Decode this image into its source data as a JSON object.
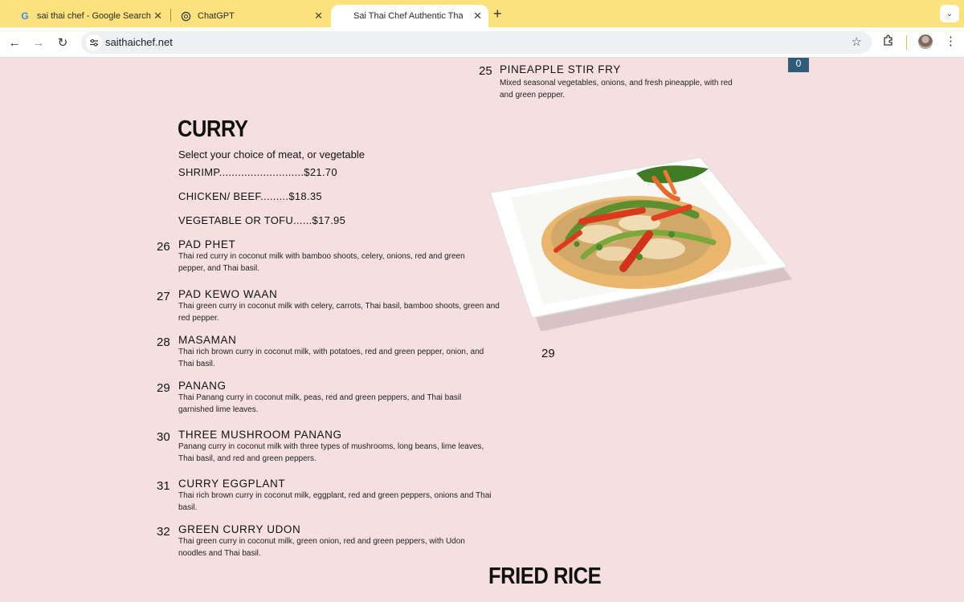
{
  "browser": {
    "tabs": [
      {
        "title": "sai thai chef - Google Search",
        "icon": "google-icon"
      },
      {
        "title": "ChatGPT",
        "icon": "chatgpt-icon"
      },
      {
        "title": "Sai Thai Chef Authentic Thai C",
        "icon": "none"
      }
    ],
    "url": "saithaichef.net",
    "new_tab_symbol": "+"
  },
  "cart": {
    "count": "0"
  },
  "top_item": {
    "number": "25",
    "name": "PINEAPPLE STIR FRY",
    "description": "Mixed seasonal vegetables, onions, and fresh pineapple, with red and green pepper."
  },
  "curry": {
    "heading": "CURRY",
    "subtitle": "Select your choice of meat, or vegetable",
    "prices": [
      "SHRIMP...........................$21.70",
      "CHICKEN/ BEEF.........$18.35",
      "VEGETABLE OR TOFU......$17.95"
    ],
    "items": [
      {
        "number": "26",
        "name": "PAD PHET",
        "description": "Thai red curry in coconut milk with bamboo shoots, celery, onions,  red and green pepper, and Thai basil."
      },
      {
        "number": "27",
        "name": "PAD KEWO WAAN",
        "description": "Thai green curry in coconut milk with celery, carrots, Thai basil,  bamboo shoots, green and red pepper."
      },
      {
        "number": "28",
        "name": "MASAMAN",
        "description": "Thai rich brown curry in coconut milk, with potatoes, red and green pepper, onion, and Thai basil."
      },
      {
        "number": "29",
        "name": "PANANG",
        "description": "Thai Panang curry in coconut milk, peas, red and green peppers, and Thai basil garnished lime leaves."
      },
      {
        "number": "30",
        "name": "THREE MUSHROOM PANANG",
        "description": "Panang curry in coconut milk with three types of mushrooms, long beans, lime leaves, Thai basil, and red and green peppers."
      },
      {
        "number": "31",
        "name": "CURRY EGGPLANT",
        "description": "Thai rich brown curry in coconut milk,  eggplant, red and green peppers, onions and Thai basil."
      },
      {
        "number": "32",
        "name": "GREEN CURRY UDON",
        "description": "Thai green curry in coconut milk, green onion, red and green peppers, with Udon noodles and Thai basil."
      }
    ]
  },
  "photo": {
    "caption": "29"
  },
  "next_section": {
    "heading": "FRIED RICE"
  },
  "colors": {
    "page_bg": "#f5dfe1",
    "tabbar_bg": "#fbe27c",
    "cart_bg": "#2f5a78"
  }
}
